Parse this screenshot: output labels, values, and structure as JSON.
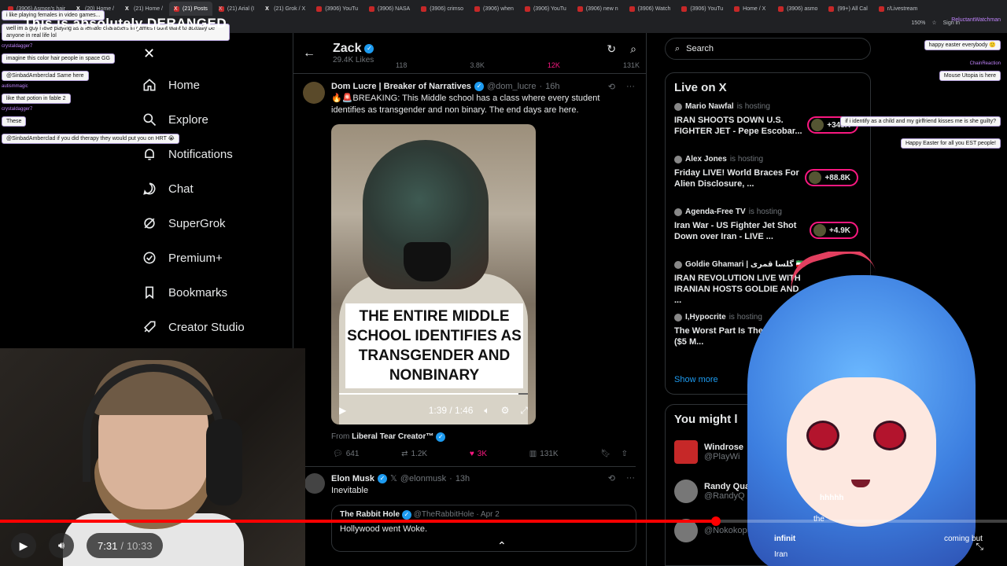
{
  "browser": {
    "tabs": [
      "(3906) Asmon's hair",
      "(20) Home /",
      "(21) Home /",
      "(21) Posts",
      "(21) Arial (I",
      "(21) Grok / X",
      "(3906) YouTu",
      "(3906) NASA",
      "(3906) crimso",
      "(3906) when",
      "(3906) YouTu",
      "(3906) new n",
      "(3906) Watch",
      "(3906) YouTu",
      "Home / X",
      "(3906) asmo",
      "(99+) All Cal",
      "r/Livestream"
    ],
    "active_tab_index": 3,
    "zoom": "150%",
    "signin": "Sign in"
  },
  "nav": {
    "items": [
      {
        "label": "Home",
        "icon": "home-icon"
      },
      {
        "label": "Explore",
        "icon": "search-icon"
      },
      {
        "label": "Notifications",
        "icon": "bell-icon"
      },
      {
        "label": "Chat",
        "icon": "chat-icon"
      },
      {
        "label": "SuperGrok",
        "icon": "grok-icon"
      },
      {
        "label": "Premium+",
        "icon": "premium-icon"
      },
      {
        "label": "Bookmarks",
        "icon": "bookmark-icon"
      },
      {
        "label": "Creator Studio",
        "icon": "rocket-icon"
      }
    ]
  },
  "feed": {
    "profile_name": "Zack",
    "profile_likes": "29.4K Likes",
    "prev_stats": [
      "118",
      "3.8K",
      "12K",
      "131K"
    ],
    "tweet1": {
      "display_name": "Dom Lucre | Breaker of Narratives",
      "handle": "@dom_lucre",
      "time": "16h",
      "text": "🔥🚨BREAKING: This Middle school has a class where every student identifies as transgender and non binary. The end days are here.",
      "video_caption": "THE ENTIRE MIDDLE SCHOOL IDENTIFIES AS TRANSGENDER AND NONBINARY",
      "video_time": "1:39 / 1:46",
      "video_progress": 0.95,
      "from_label": "From",
      "from_source": "Liberal Tear Creator™",
      "replies": "641",
      "reposts": "1.2K",
      "likes": "3K",
      "views": "131K"
    },
    "tweet2": {
      "display_name": "Elon Musk",
      "handle": "@elonmusk",
      "time": "13h",
      "text": "Inevitable",
      "quote_name": "The Rabbit Hole",
      "quote_handle": "@TheRabbitHole",
      "quote_time": "Apr 2",
      "quote_text": "Hollywood went Woke."
    }
  },
  "right": {
    "search_placeholder": "Search",
    "live_title": "Live on X",
    "hosting_label": "is hosting",
    "live_items": [
      {
        "host": "Mario Nawfal",
        "title": "IRAN SHOOTS DOWN U.S. FIGHTER JET - Pepe Escobar...",
        "viewers": "+343K"
      },
      {
        "host": "Alex Jones",
        "title": "Friday LIVE! World Braces For Alien Disclosure, ...",
        "viewers": "+88.8K"
      },
      {
        "host": "Agenda-Free TV",
        "title": "Iran War - US Fighter Jet Shot Down over Iran - LIVE ...",
        "viewers": "+4.9K"
      },
      {
        "host": "Goldie Ghamari | گلسا قمری 🇮🇷",
        "title": "IRAN REVOLUTION LIVE WITH IRANIAN HOSTS GOLDIE AND ...",
        "viewers": ""
      },
      {
        "host": "I,Hypocrite",
        "title": "The Worst Part Is The Hypocrisy ($5 M...",
        "viewers": ""
      }
    ],
    "show_more": "Show more",
    "wtf_title": "You might l",
    "wtf_items": [
      {
        "name": "Windrose",
        "handle": "@PlayWi"
      },
      {
        "name": "Randy Qua",
        "handle": "@RandyQ"
      },
      {
        "name": "",
        "handle": "@Nokokopuffs"
      }
    ]
  },
  "chat_left": {
    "title_overlay": "This is absolutely DERANGED",
    "messages": [
      {
        "user": "",
        "text": "i like playing females in video games..."
      },
      {
        "user": "",
        "text": "well im a guy i love playing as a female characters in games i dont want to actually be anyone in real life lol"
      },
      {
        "user": "crystaldagger7",
        "text": "imagine this color hair people in space GG"
      },
      {
        "user": "",
        "text": "@SinbadAmberclad Same here"
      },
      {
        "user": "autismmagic",
        "text": "like that potion in fable 2"
      },
      {
        "user": "crystaldagger7",
        "text": "These"
      },
      {
        "user": "",
        "text": "@SinbadAmberclad if you did therapy they would put you on HRT 😭"
      }
    ]
  },
  "chat_right": {
    "top_user": "ReluctantWatchman",
    "messages": [
      {
        "user": "",
        "text": "happy easter everybody 🙂"
      },
      {
        "user": "ChainReaction",
        "text": "Mouse Utopia is here"
      },
      {
        "user": "",
        "text": "if i identify as a child and my girlfriend kisses me is she guilty?"
      },
      {
        "user": "",
        "text": "Happy Easter for all you EST people!"
      }
    ]
  },
  "player": {
    "current_time": "7:31",
    "separator": "/",
    "duration": "10:33",
    "progress": 0.715
  },
  "vtuber_overlay": {
    "line1": "infinit",
    "line2": "Iran",
    "side1": "hhhhh",
    "side2": "the",
    "side3": "coming but"
  }
}
